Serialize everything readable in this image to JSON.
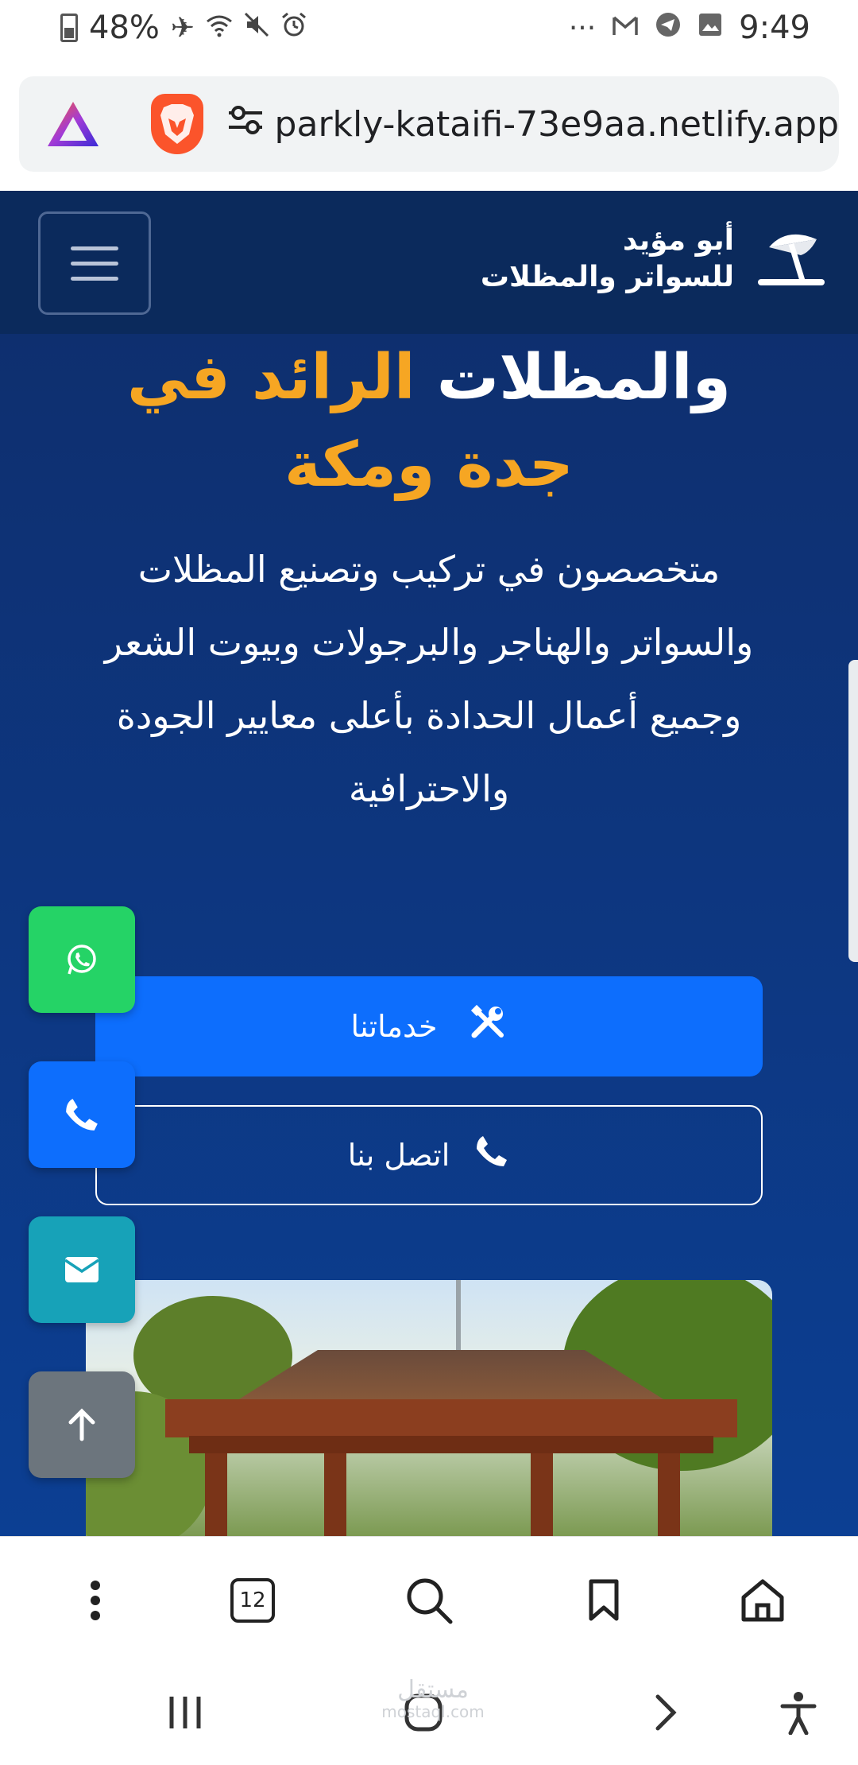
{
  "status_bar": {
    "battery": "48%",
    "time": "9:49",
    "left_icons": [
      "battery-icon",
      "airplane-icon",
      "wifi-icon",
      "mute-icon",
      "alarm-icon"
    ],
    "right_icons": [
      "more-dots-icon",
      "gmail-icon",
      "telegram-icon",
      "gallery-icon"
    ]
  },
  "browser": {
    "url": "parkly-kataifi-73e9aa.netlify.app",
    "tabs_count": "12"
  },
  "header": {
    "brand_line1": "أبو مؤيد",
    "brand_line2": "للسواتر والمظلات"
  },
  "hero": {
    "title_white": "والمظلات",
    "title_accent": "الرائد في",
    "title_line2": "جدة ومكة",
    "description": "متخصصون في تركيب وتصنيع المظلات والسواتر والهناجر والبرجولات وبيوت الشعر وجميع أعمال الحدادة بأعلى معايير الجودة والاحترافية",
    "services_button": "خدماتنا",
    "contact_button": "اتصل بنا"
  },
  "watermark": {
    "line1": "مستقل",
    "line2": "mostaql.com"
  },
  "colors": {
    "header_bg": "#0b2a5c",
    "accent": "#f6a623",
    "primary": "#0d6efd",
    "whatsapp": "#25d366",
    "mail": "#17a2b8",
    "scroll_top": "#6c757d"
  }
}
